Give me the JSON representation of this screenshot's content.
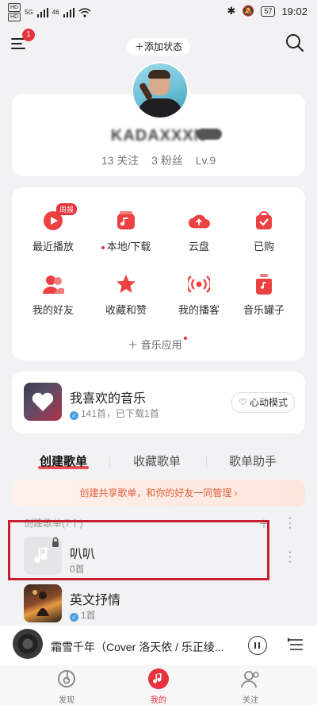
{
  "status_bar": {
    "sim1": "HD",
    "sim2": "HD",
    "network": "5G",
    "network2": "46",
    "battery": "57",
    "time": "19:02"
  },
  "header": {
    "menu_badge": "1",
    "add_status": "＋添加状态"
  },
  "profile": {
    "username": "KADAXXXN",
    "follow": "13 关注",
    "fans": "3 粉丝",
    "level": "Lv.9"
  },
  "features": [
    {
      "label": "最近播放",
      "tag": "周报",
      "icon": "play-icon",
      "color": "#ec4141"
    },
    {
      "label": "本地/下载",
      "icon": "music-folder-icon",
      "color": "#ec4141"
    },
    {
      "label": "云盘",
      "icon": "cloud-upload-icon",
      "color": "#ec4141"
    },
    {
      "label": "已购",
      "icon": "bag-check-icon",
      "color": "#ec4141"
    },
    {
      "label": "我的好友",
      "icon": "friends-icon",
      "color": "#ec4141"
    },
    {
      "label": "收藏和赞",
      "icon": "star-icon",
      "color": "#ec4141"
    },
    {
      "label": "我的播客",
      "icon": "podcast-icon",
      "color": "#ec4141"
    },
    {
      "label": "音乐罐子",
      "icon": "music-jar-icon",
      "color": "#ec4141"
    }
  ],
  "music_apps": "＋ 音乐应用",
  "liked": {
    "title": "我喜欢的音乐",
    "subtitle": "141首，已下载1首",
    "heart_mode": "心动模式"
  },
  "tabs": [
    "创建歌单",
    "收藏歌单",
    "歌单助手"
  ],
  "banner": "创建共享歌单，和你的好友一同管理 ›",
  "created_header": "创建歌单(7个)",
  "playlists": [
    {
      "name": "叭叭",
      "count": "0首"
    },
    {
      "name": "英文抒情",
      "count": "1首"
    }
  ],
  "player": {
    "song": "霜雪千年（Cover 洛天依 / 乐正绫..."
  },
  "nav": [
    {
      "label": "发现",
      "icon": "netease-logo-icon"
    },
    {
      "label": "我的",
      "icon": "music-note-icon"
    },
    {
      "label": "关注",
      "icon": "follow-icon"
    }
  ],
  "colors": {
    "accent": "#e8323c",
    "highlight_box": "#c81e2e"
  }
}
